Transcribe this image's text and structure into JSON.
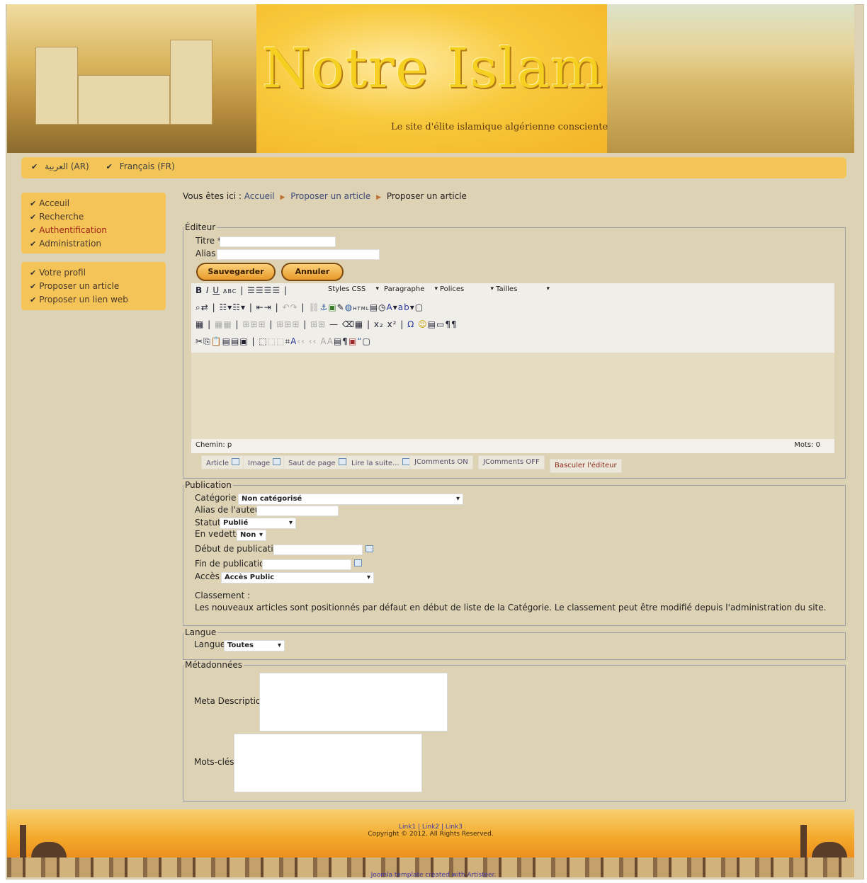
{
  "header": {
    "title": "Notre Islam",
    "subtitle": "Le site d'élite islamique algérienne consciente"
  },
  "languages": [
    {
      "label": "العربية (AR)"
    },
    {
      "label": "Français (FR)"
    }
  ],
  "menu_main": [
    {
      "label": "Acceuil"
    },
    {
      "label": "Recherche"
    },
    {
      "label": "Authentification"
    },
    {
      "label": "Administration"
    }
  ],
  "menu_user": [
    {
      "label": "Votre profil"
    },
    {
      "label": "Proposer un article"
    },
    {
      "label": "Proposer un lien web"
    }
  ],
  "breadcrumb": {
    "prefix": "Vous êtes ici :",
    "items": [
      "Accueil",
      "Proposer un article",
      "Proposer un article"
    ]
  },
  "editor": {
    "legend": "Éditeur",
    "title_label": "Titre *",
    "alias_label": "Alias",
    "save_label": "Sauvegarder",
    "cancel_label": "Annuler",
    "styles_select": "Styles CSS",
    "format_select": "Paragraphe",
    "font_select": "Polices",
    "size_select": "Tailles",
    "path_label": "Chemin: p",
    "word_count": "Mots: 0",
    "extra_buttons": [
      "Article",
      "Image",
      "Saut de page",
      "Lire la suite...",
      "JComments ON",
      "JComments OFF",
      "Basculer l'éditeur"
    ]
  },
  "publication": {
    "legend": "Publication",
    "category_label": "Catégorie *",
    "category_value": "Non catégorisé",
    "author_alias_label": "Alias de l'auteur",
    "status_label": "Statut",
    "status_value": "Publié",
    "featured_label": "En vedette",
    "featured_value": "Non",
    "start_label": "Début de publication",
    "end_label": "Fin de publication",
    "access_label": "Accès",
    "access_value": "Accès Public",
    "ordering_label": "Classement :",
    "ordering_text": "Les nouveaux articles sont positionnés par défaut en début de liste de la Catégorie. Le classement peut être modifié depuis l'administration du site."
  },
  "language_section": {
    "legend": "Langue",
    "label": "Langue",
    "value": "Toutes"
  },
  "metadata": {
    "legend": "Métadonnées",
    "description_label": "Meta Description",
    "keywords_label": "Mots-clés"
  },
  "footer": {
    "links": "Link1 | Link2 | Link3",
    "copyright": "Copyright © 2012. All Rights Reserved.",
    "credit": "Joomla template created with Artisteer."
  },
  "colors": {
    "accent": "#f5c458",
    "active_menu": "#a0261a",
    "link": "#3b4a7a"
  }
}
